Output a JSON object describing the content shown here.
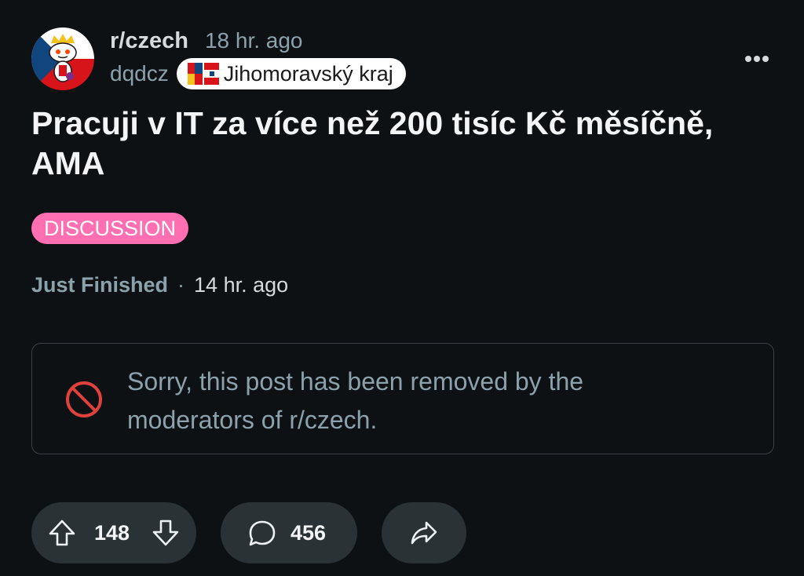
{
  "post": {
    "subreddit": "r/czech",
    "posted_time": "18 hr. ago",
    "username": "dqdcz",
    "user_flair": "Jihomoravský kraj",
    "title": "Pracuji v IT za více než 200 tisíc Kč měsíčně, AMA",
    "post_flair": "DISCUSSION",
    "edited_label": "Just Finished",
    "edited_separator": "·",
    "edited_time": "14 hr. ago",
    "removed_message": "Sorry, this post has been removed by the moderators of r/czech."
  },
  "actions": {
    "score": "148",
    "comment_count": "456"
  },
  "icons": {
    "avatar": "snoo-king-avatar",
    "more": "more-options-icon",
    "removed": "prohibited-icon",
    "upvote": "upvote-arrow-icon",
    "downvote": "downvote-arrow-icon",
    "comment": "comment-bubble-icon",
    "share": "share-arrow-icon"
  },
  "colors": {
    "background": "#0e1113",
    "flair_tag": "#ff6fb2",
    "pill": "#2a3236",
    "removed_icon": "#e0413c",
    "muted_text": "#8ba2ad"
  }
}
